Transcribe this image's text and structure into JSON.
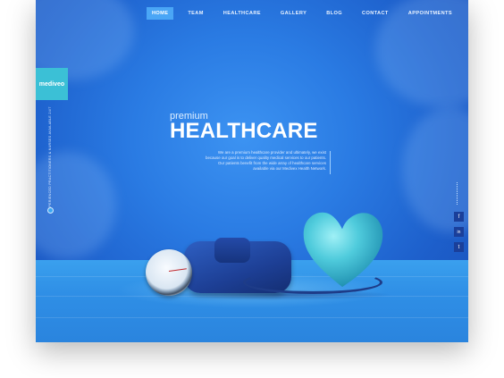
{
  "brand": {
    "logo_text": "mediveo",
    "accent": "#3bc0d6"
  },
  "nav": {
    "items": [
      {
        "label": "HOME",
        "active": true
      },
      {
        "label": "TEAM",
        "active": false
      },
      {
        "label": "HEALTHCARE",
        "active": false
      },
      {
        "label": "GALLERY",
        "active": false
      },
      {
        "label": "BLOG",
        "active": false
      },
      {
        "label": "CONTACT",
        "active": false
      },
      {
        "label": "APPOINTMENTS",
        "active": false
      }
    ]
  },
  "side": {
    "vertical_text": "EXPERIENCED PRACTITIONERS & NURSES AVAILABLE 24/7"
  },
  "hero": {
    "kicker": "premium",
    "title": "HEALTHCARE",
    "description": "We are a premium healthcare provider and ultimately, we exist because our goal is to deliver quality medical services to our patients. Our patients benefit from the wide array of healthcare services available via our Medivex Health Network."
  },
  "social": {
    "items": [
      {
        "icon": "facebook-icon",
        "glyph": "f"
      },
      {
        "icon": "linkedin-icon",
        "glyph": "in"
      },
      {
        "icon": "twitter-icon",
        "glyph": "t"
      }
    ]
  },
  "colors": {
    "background": "#2a7be3",
    "nav_active": "#4aa6f6",
    "social_bg": "#1a3f9a"
  }
}
